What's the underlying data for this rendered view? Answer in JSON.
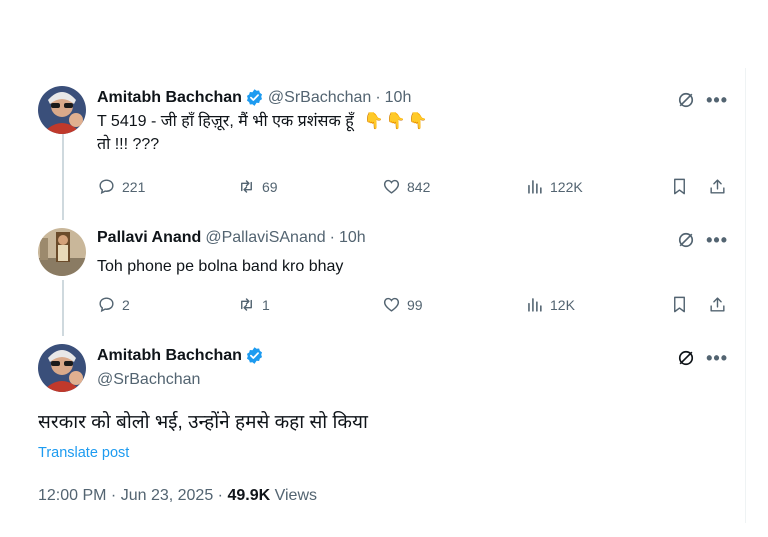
{
  "tweet1": {
    "name": "Amitabh Bachchan",
    "handle": "@SrBachchan",
    "time": "10h",
    "line1": "T 5419 - जी हाँ हिज़ूर, मैं भी एक प्रशंसक हूँ",
    "emoji": "👇👇👇",
    "line2": "तो !!! ???",
    "replies": "221",
    "reposts": "69",
    "likes": "842",
    "views": "122K"
  },
  "tweet2": {
    "name": "Pallavi Anand",
    "handle": "@PallaviSAnand",
    "time": "10h",
    "text": "Toh phone pe bolna band kro bhay",
    "replies": "2",
    "reposts": "1",
    "likes": "99",
    "views": "12K"
  },
  "main_tweet": {
    "name": "Amitabh Bachchan",
    "handle": "@SrBachchan",
    "text": "सरकार को बोलो भई, उन्होंने हमसे कहा सो किया",
    "translate": "Translate post",
    "timestamp": "12:00 PM · Jun 23, 2025 · ",
    "views_count": "49.9K",
    "views_label": " Views"
  },
  "separator": "·",
  "more_glyph": "•••",
  "colors": {
    "verified": "#1d9bf0",
    "muted": "#536471",
    "text": "#0f1419",
    "link": "#1d9bf0"
  }
}
